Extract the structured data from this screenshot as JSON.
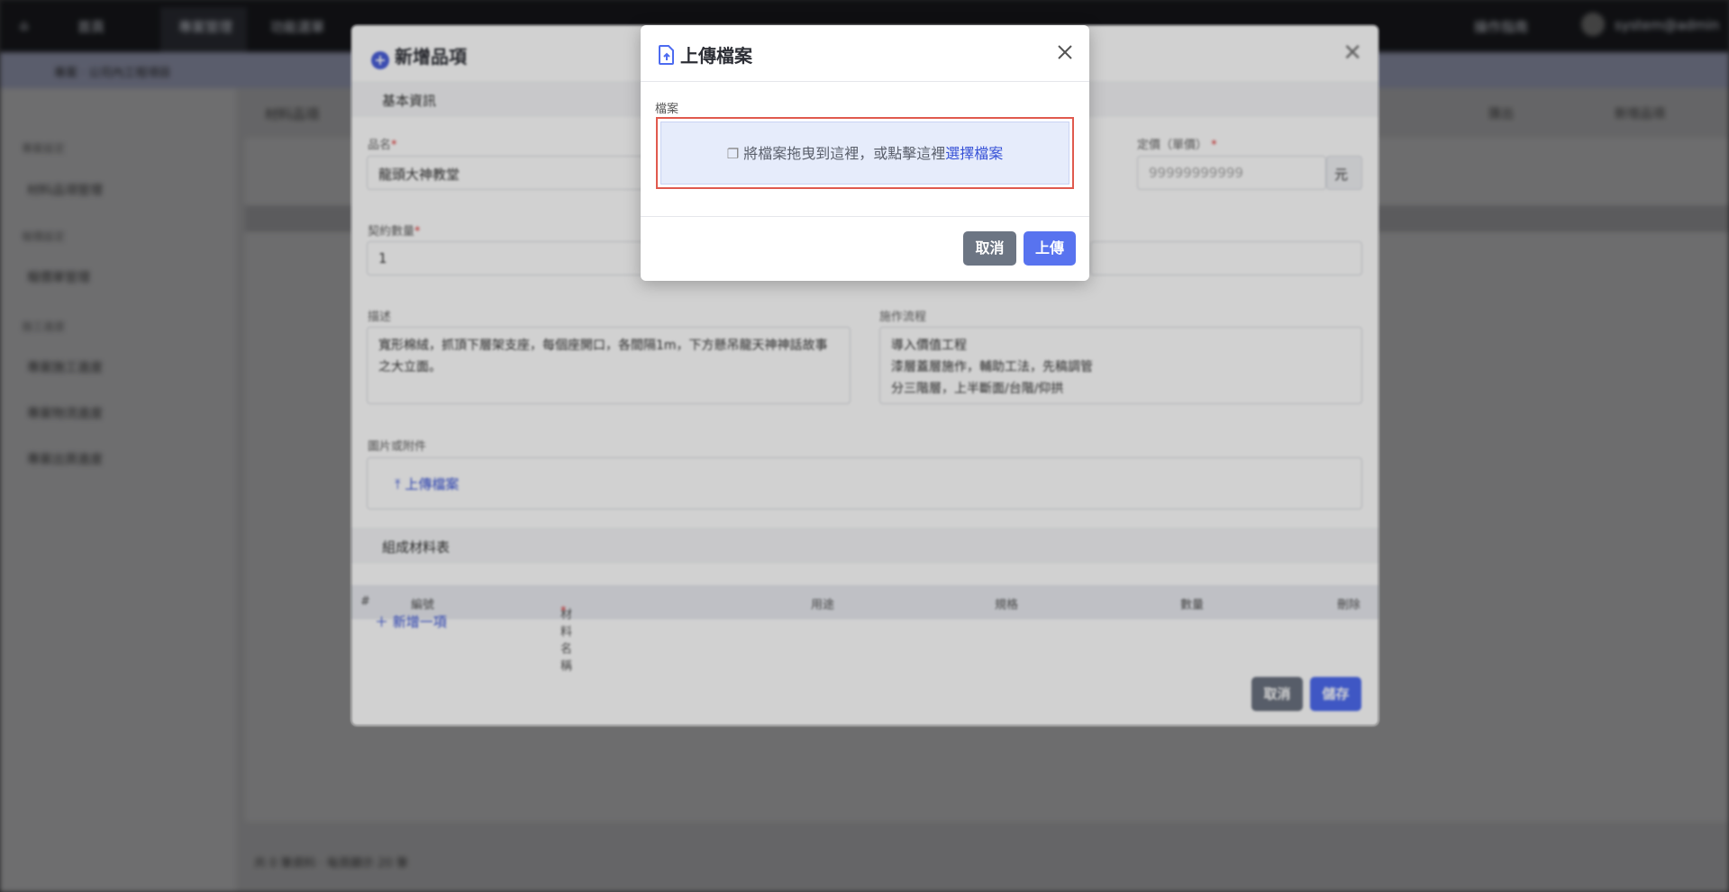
{
  "background": {
    "nav": [
      "首頁",
      "專案管理",
      "功能選單"
    ],
    "nav_right": [
      "操作指南",
      "system@admin"
    ],
    "breadcrumb": "專案 · 公司內工程項目",
    "sidebar": {
      "groups": [
        "專案設定",
        "報價設定",
        "施工進度"
      ],
      "items": [
        "材料品項管理",
        "報價單管理",
        "專案施工進度",
        "專案物流進度",
        "專案出貨進度"
      ]
    },
    "main_tab": "材料品項",
    "footer": "共 0 筆資料 · 每頁顯示 20 筆",
    "header_buttons": [
      "匯出",
      "新增品項"
    ]
  },
  "item_modal": {
    "title": "新增品項",
    "section_basic": "基本資訊",
    "name_label": "品名",
    "name_value": "龍頭大神教堂",
    "price_label": "定價（單價）",
    "price_placeholder": "99999999999",
    "price_unit": "元",
    "qty_label": "契約數量",
    "qty_value": "1",
    "desc_label": "描述",
    "desc_value": "寬形棉絨，抓頂下層架支座，每個座開口，各間隔1m，下方懸吊龍天神神話故事之大立面。",
    "process_label": "施作流程",
    "process_value": "導入價值工程\n漆層蓋層施作，輔助工法，先稿調管\n分三階層，上半斷面/台階/仰拱",
    "attach_label": "圖片或附件",
    "attach_button": "上傳檔案",
    "section_materials": "組成材料表",
    "table_headers": [
      "#",
      "編號",
      "材料名稱",
      "用途",
      "規格",
      "數量",
      "刪除"
    ],
    "add_row": "新增一項",
    "cancel": "取消",
    "save": "儲存"
  },
  "upload_modal": {
    "title": "上傳檔案",
    "field_label": "檔案",
    "drop_text": "將檔案拖曳到這裡，或點擊這裡",
    "drop_link": "選擇檔案",
    "cancel": "取消",
    "upload": "上傳",
    "colors": {
      "accent": "#5873ef",
      "highlight": "#e05a4e",
      "dropzone_bg": "#e6ecfb"
    }
  }
}
